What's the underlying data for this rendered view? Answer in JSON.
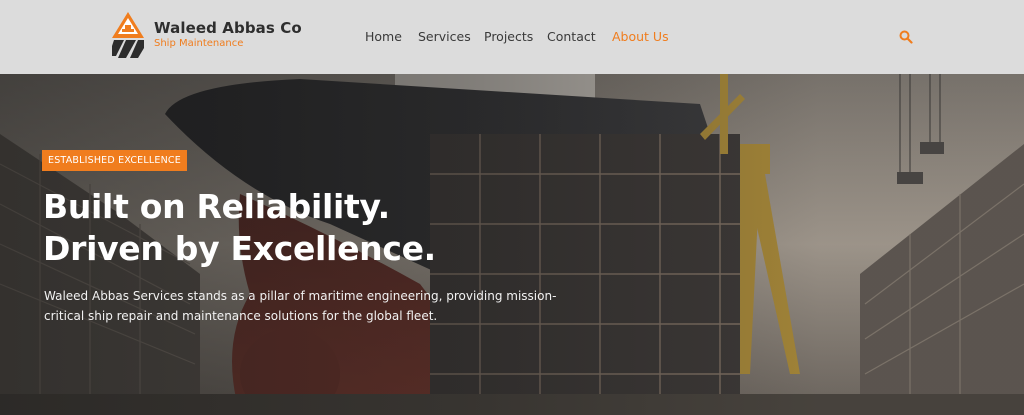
{
  "brand": {
    "name": "Waleed Abbas Co",
    "tagline": "Ship Maintenance",
    "accent_color": "#f07d1e",
    "logo_icon": "ship-hull-triangle-logo"
  },
  "nav": {
    "items": [
      {
        "label": "Home",
        "active": false
      },
      {
        "label": "Services",
        "active": false
      },
      {
        "label": "Projects",
        "active": false
      },
      {
        "label": "Contact",
        "active": false
      },
      {
        "label": "About Us",
        "active": true
      }
    ],
    "search_icon": "search-icon"
  },
  "hero": {
    "badge": "ESTABLISHED EXCELLENCE",
    "headline_line1": "Built on Reliability.",
    "headline_line2": "Driven by Excellence.",
    "lead": "Waleed Abbas Services stands as a pillar of maritime engineering, providing mission-critical ship repair and maintenance solutions for the global fleet.",
    "background_image": "ship in dry dock under construction with cranes and scaffolding"
  }
}
